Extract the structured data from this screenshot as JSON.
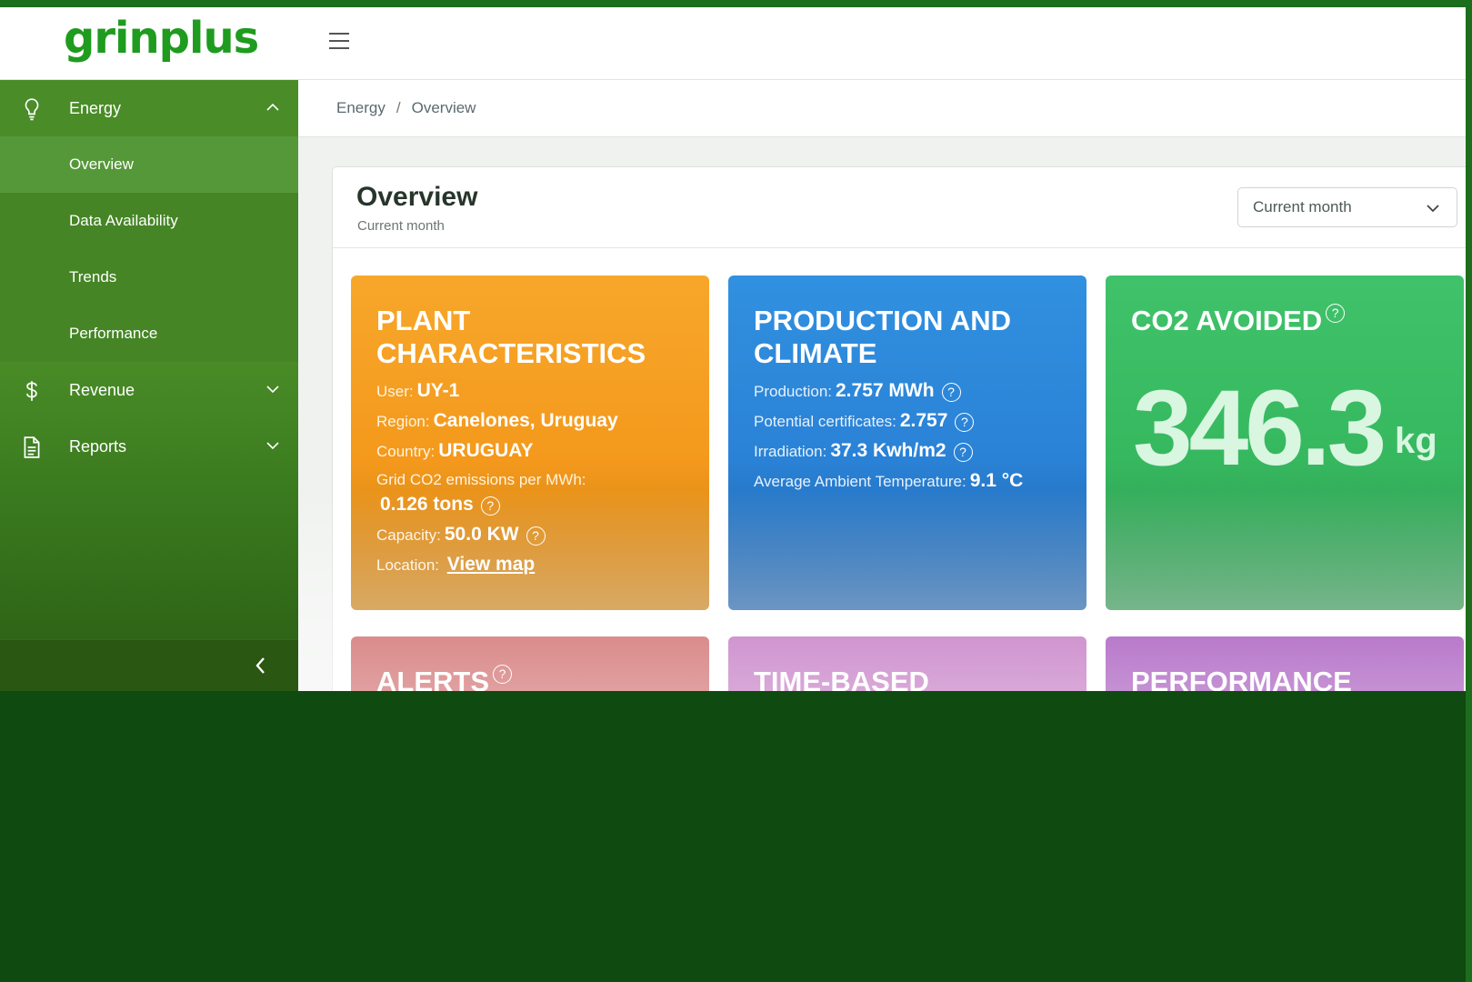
{
  "app": {
    "logo": "grinplus",
    "accent_color": "#1f9b1f",
    "sidebar_color": "#4a8c27"
  },
  "sidebar": {
    "sections": [
      {
        "label": "Energy",
        "icon": "lightbulb-icon",
        "expanded": true
      },
      {
        "label": "Revenue",
        "icon": "dollar-icon",
        "expanded": false
      },
      {
        "label": "Reports",
        "icon": "document-icon",
        "expanded": false
      }
    ],
    "energy_items": [
      "Overview",
      "Data Availability",
      "Trends",
      "Performance"
    ],
    "active_item": "Overview"
  },
  "breadcrumb": {
    "items": [
      "Energy",
      "Overview"
    ],
    "separator": "/"
  },
  "overview": {
    "title": "Overview",
    "subtitle": "Current month",
    "period_select": "Current month"
  },
  "cards": {
    "plant": {
      "title_line1": "PLANT",
      "title_line2": "CHARACTERISTICS",
      "user_label": "User:",
      "user_value": "UY-1",
      "region_label": "Region:",
      "region_value": "Canelones, Uruguay",
      "country_label": "Country:",
      "country_value": "URUGUAY",
      "grid_label": "Grid CO2 emissions per MWh:",
      "grid_value": "0.126 tons",
      "capacity_label": "Capacity:",
      "capacity_value": "50.0 KW",
      "location_label": "Location:",
      "location_link": "View map",
      "color": "#f4991c"
    },
    "production": {
      "title_line1": "PRODUCTION AND",
      "title_line2": "CLIMATE",
      "production_label": "Production:",
      "production_value": "2.757 MWh",
      "certificates_label": "Potential certificates:",
      "certificates_value": "2.757",
      "irradiation_label": "Irradiation:",
      "irradiation_value": "37.3 Kwh/m2",
      "temperature_label": "Average Ambient Temperature:",
      "temperature_value": "9.1 °C",
      "color": "#2a82d6"
    },
    "co2": {
      "title": "CO2 AVOIDED",
      "value": "346.3",
      "unit": "kg",
      "color": "#36b85f"
    },
    "alerts": {
      "title": "ALERTS",
      "color": "#c23f3f"
    },
    "time_based": {
      "title": "TIME-BASED",
      "color": "#b14fb0"
    },
    "performance": {
      "title": "PERFORMANCE",
      "color": "#8a22a8"
    },
    "help_glyph": "?"
  }
}
